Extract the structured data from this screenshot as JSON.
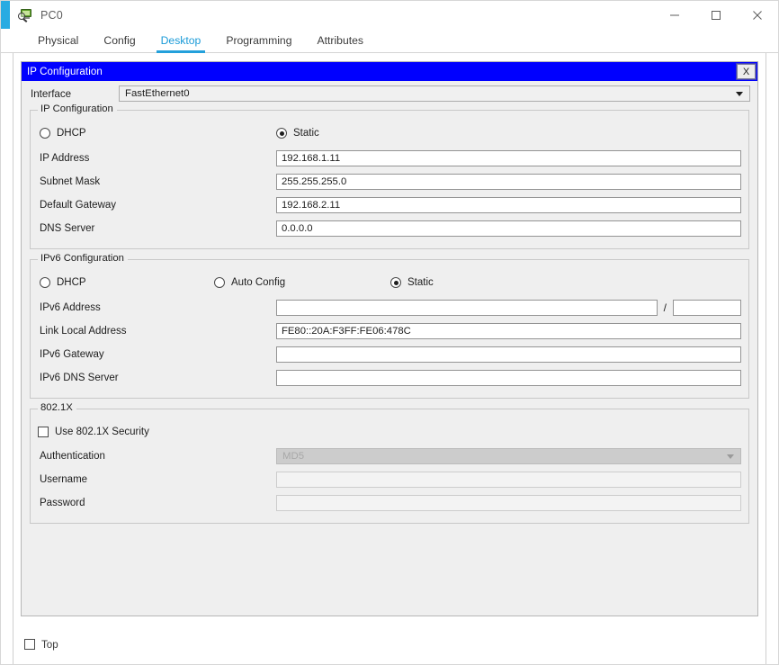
{
  "window": {
    "title": "PC0",
    "icon": "pc-magnifier-icon",
    "accent_color": "#29abe2",
    "controls": {
      "minimize": "minimize-icon",
      "maximize": "maximize-icon",
      "close": "close-icon"
    }
  },
  "tabs": [
    {
      "label": "Physical",
      "active": false
    },
    {
      "label": "Config",
      "active": false
    },
    {
      "label": "Desktop",
      "active": true
    },
    {
      "label": "Programming",
      "active": false
    },
    {
      "label": "Attributes",
      "active": false
    }
  ],
  "active_tab_color": "#1b9bd8",
  "ip_config": {
    "title": "IP Configuration",
    "title_bar_color": "#0000ff",
    "close_label": "X",
    "interface": {
      "label": "Interface",
      "value": "FastEthernet0"
    },
    "ipv4": {
      "group_title": "IP Configuration",
      "dhcp_label": "DHCP",
      "dhcp_selected": false,
      "static_label": "Static",
      "static_selected": true,
      "fields": [
        {
          "label": "IP Address",
          "value": "192.168.1.11"
        },
        {
          "label": "Subnet Mask",
          "value": "255.255.255.0"
        },
        {
          "label": "Default Gateway",
          "value": "192.168.2.11"
        },
        {
          "label": "DNS Server",
          "value": "0.0.0.0"
        }
      ]
    },
    "ipv6": {
      "group_title": "IPv6 Configuration",
      "dhcp_label": "DHCP",
      "dhcp_selected": false,
      "auto_config_label": "Auto Config",
      "auto_config_selected": false,
      "static_label": "Static",
      "static_selected": true,
      "address_label": "IPv6 Address",
      "address_value": "",
      "prefix_separator": "/",
      "prefix_value": "",
      "link_local_label": "Link Local Address",
      "link_local_value": "FE80::20A:F3FF:FE06:478C",
      "gateway_label": "IPv6 Gateway",
      "gateway_value": "",
      "dns_label": "IPv6 DNS Server",
      "dns_value": ""
    },
    "dot1x": {
      "group_title": "802.1X",
      "use_security_label": "Use 802.1X Security",
      "use_security_checked": false,
      "authentication_label": "Authentication",
      "authentication_value": "MD5",
      "username_label": "Username",
      "username_value": "",
      "password_label": "Password",
      "password_value": ""
    }
  },
  "bottom": {
    "top_checkbox_label": "Top",
    "top_checkbox_checked": false
  }
}
